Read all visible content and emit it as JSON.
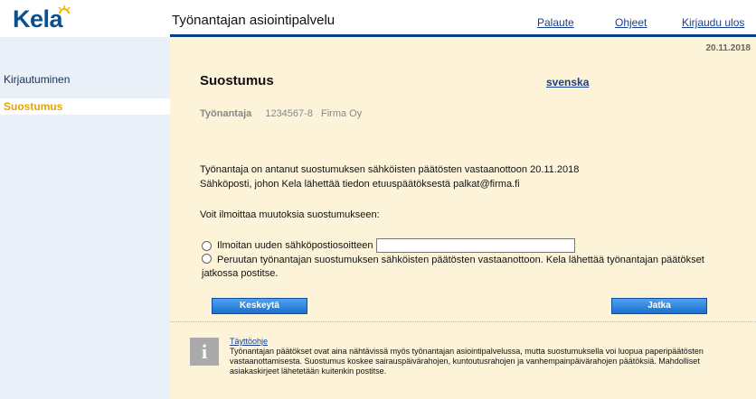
{
  "header": {
    "logo_text": "Kela",
    "service_title": "Työnantajan asiointipalvelu",
    "links": {
      "feedback": "Palaute",
      "help": "Ohjeet",
      "logout": "Kirjaudu ulos"
    },
    "brand_color": "#0b3f82"
  },
  "sidebar": {
    "items": [
      {
        "label": "Kirjautuminen"
      },
      {
        "label": "Suostumus"
      }
    ]
  },
  "main": {
    "date": "20.11.2018",
    "title": "Suostumus",
    "language_link": "svenska",
    "employer": {
      "label": "Työnantaja",
      "id": "1234567-8",
      "name": "Firma Oy"
    },
    "consent_text": "Työnantaja on antanut suostumuksen sähköisten päätösten vastaanottoon  20.11.2018",
    "email_text": "Sähköposti, johon Kela lähettää tiedon etuuspäätöksestä  palkat@firma.fi",
    "change_prompt": "Voit ilmoittaa muutoksia suostumukseen:",
    "option_new_email": "Ilmoitan uuden sähköpostiosoitteen",
    "option_new_email_value": "",
    "option_cancel": "Peruutan työnantajan suostumuksen sähköisten päätösten vastaanottoon. Kela lähettää työnantajan päätökset jatkossa postitse.",
    "buttons": {
      "cancel": "Keskeytä",
      "next": "Jatka"
    }
  },
  "help": {
    "icon": "info-icon",
    "link": "Täyttöohje",
    "text": "Työnantajan päätökset ovat aina nähtävissä myös työnantajan asiointipalvelussa, mutta suostumuksella voi luopua paperipäätösten vastaanottamisesta. Suostumus koskee sairauspäivärahojen, kuntoutusrahojen ja vanhempainpäivärahojen päätöksiä. Mahdolliset asiakaskirjeet lähetetään kuitenkin postitse."
  }
}
